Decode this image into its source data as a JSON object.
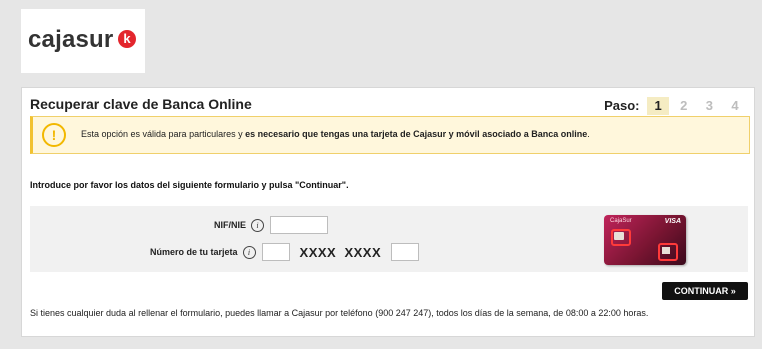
{
  "brand": {
    "logo_text": "cajasur",
    "logo_mark": "k",
    "accent": "#e3262d"
  },
  "header": {
    "title": "Recuperar clave de Banca Online",
    "steps_label": "Paso:",
    "steps": [
      "1",
      "2",
      "3",
      "4"
    ],
    "active_step": "1"
  },
  "notice": {
    "icon": "exclamation-icon",
    "text_normal": "Esta opción es válida para particulares y ",
    "text_bold": "es necesario que tengas una tarjeta de Cajasur y móvil asociado a Banca online",
    "text_end": "."
  },
  "intro": "Introduce por favor los datos del siguiente formulario y pulsa \"Continuar\".",
  "form": {
    "nif_label": "NIF/NIE",
    "nif_value": "",
    "card_label": "Número de tu tarjeta",
    "card_first_value": "",
    "card_mask": "XXXX  XXXX",
    "card_last_value": "",
    "info_glyph": "i"
  },
  "card_image": {
    "brand": "CajaSur",
    "network": "VISA"
  },
  "continue_label": "CONTINUAR »",
  "footer": "Si tienes cualquier duda al rellenar el formulario, puedes llamar a Cajasur por teléfono (900 247 247), todos los días de la semana, de 08:00 a 22:00 horas."
}
